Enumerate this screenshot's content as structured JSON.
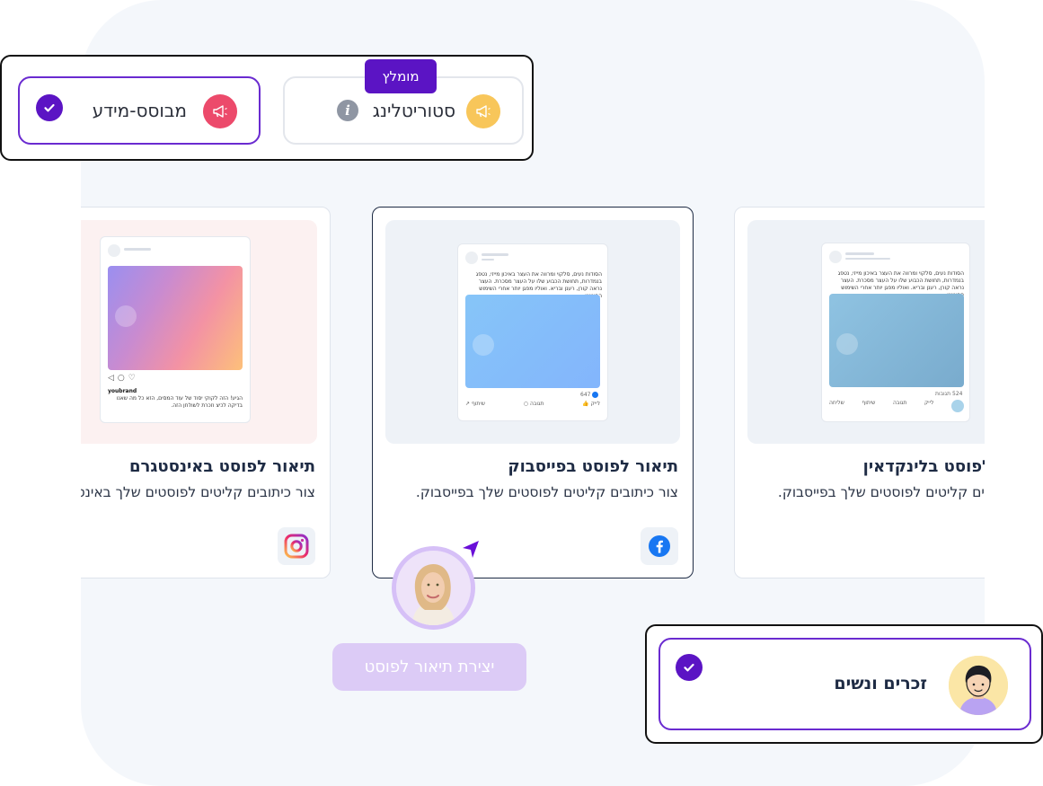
{
  "tone": {
    "options": [
      {
        "label": "מבוסס-מידע",
        "selected": true,
        "icon": "megaphone-icon",
        "icon_color": "#ec4a6b"
      },
      {
        "label": "סטוריטלינג",
        "selected": false,
        "icon": "megaphone-icon",
        "icon_color": "#f8c65a",
        "badge": "מומלץ"
      }
    ]
  },
  "cards": [
    {
      "platform": "instagram",
      "title": "תיאור לפוסט באינסטגרם",
      "description": "צור כיתובים קליטים לפוסטים שלך באינסטגרם.",
      "mock": {
        "brand": "youbrand",
        "caption": "הגיע! הזה לקוקי יסוד של עוד המסים, הזא כל מה שאנו בדיקה לכיצ וזכרת לשולחן הזה."
      }
    },
    {
      "platform": "facebook",
      "title": "תיאור לפוסט בפייסבוק",
      "description": "צור כיתובים קליטים לפוסטים שלך בפייסבוק.",
      "selected": true,
      "mock": {
        "text": "הסודות נעים, סלקוי ומרווה את העצר באיכון מייזי, נטפג בנמדרות, תחושת הכבוע שלו על העצר מסכרת. העצר נראה קורן, רענן ובריא. ואוליו מפגן יותר אחרי השימוש הראשון",
        "reactions_count": "647",
        "actions": [
          "לייק",
          "תגובה",
          "שיתוף"
        ]
      }
    },
    {
      "platform": "linkedin",
      "title": "תיאור לפוסט בלינקדאין",
      "description": "צור כיתובים קליטים לפוסטים שלך בפייסבוק.",
      "mock": {
        "text": "הסודות נעים, סלקוי ומרווה את העצר באיכון מייזי, נטפג בנמדרות, תחושת הכבוע שלו על העצר מסכרת. העצר נראה קורן, רענן ובריא. ואוליו מפגן יותר אחרי השימוש הראשון",
        "reactions_count": "524 תגובות",
        "actions": [
          "לייק",
          "תגובה",
          "שיתוף",
          "שליחה"
        ]
      }
    }
  ],
  "create_button": "יצירת תיאור לפוסט",
  "audience": {
    "label": "זכרים ונשים",
    "selected": true
  },
  "colors": {
    "accent": "#5b14c4",
    "accent_light": "#dccbf6",
    "facebook": "#1877f2"
  }
}
